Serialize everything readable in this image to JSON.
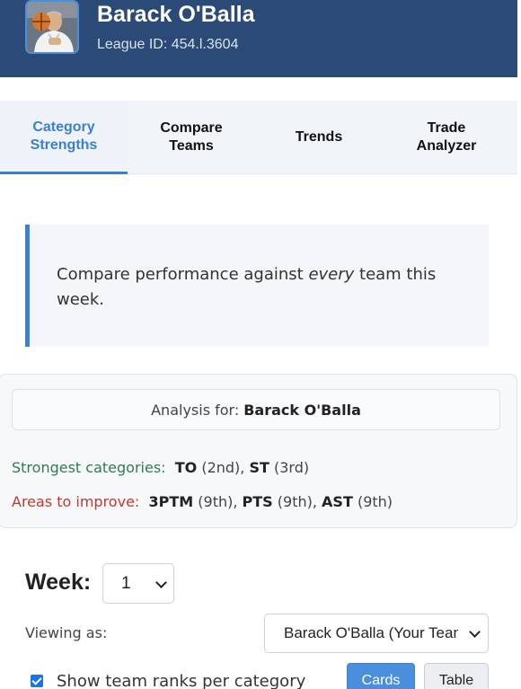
{
  "header": {
    "team_name": "Barack O'Balla",
    "league_id": "League ID: 454.l.3604"
  },
  "tabs": [
    {
      "line1": "Category",
      "line2": "Strengths",
      "active": true
    },
    {
      "line1": "Compare",
      "line2": "Teams",
      "active": false
    },
    {
      "line1": "Trends",
      "line2": "",
      "active": false
    },
    {
      "line1": "Trade",
      "line2": "Analyzer",
      "active": false
    }
  ],
  "info": {
    "text_before": "Compare performance against ",
    "text_emphasis": "every",
    "text_after": " team this week."
  },
  "analysis": {
    "for_label": "Analysis for:",
    "team": "Barack O'Balla",
    "strongest_label": "Strongest categories:",
    "strongest": [
      {
        "cat": "TO",
        "rank": "(2nd)"
      },
      {
        "cat": "ST",
        "rank": "(3rd)"
      }
    ],
    "improve_label": "Areas to improve:",
    "improve": [
      {
        "cat": "3PTM",
        "rank": "(9th)"
      },
      {
        "cat": "PTS",
        "rank": "(9th)"
      },
      {
        "cat": "AST",
        "rank": "(9th)"
      }
    ]
  },
  "controls": {
    "week_label": "Week:",
    "week_value": "1",
    "viewing_label": "Viewing as:",
    "viewing_value": "Barack O'Balla (Your Team)",
    "show_ranks_label": "Show team ranks per category",
    "show_ranks_checked": true,
    "cards_label": "Cards",
    "table_label": "Table"
  },
  "colors": {
    "header_bg": "#2b4a78",
    "accent": "#3b7fd0",
    "strong": "#2e7d4f",
    "weak": "#c0392b"
  }
}
